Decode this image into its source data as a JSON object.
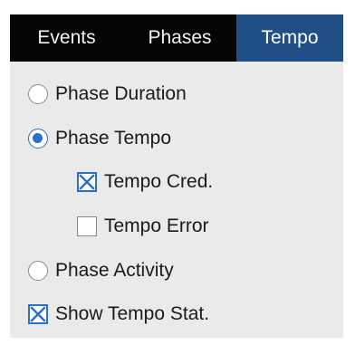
{
  "tabs": [
    {
      "label": "Events",
      "active": false
    },
    {
      "label": "Phases",
      "active": false
    },
    {
      "label": "Tempo",
      "active": true
    }
  ],
  "options": {
    "phase_duration": {
      "label": "Phase Duration",
      "type": "radio",
      "checked": false
    },
    "phase_tempo": {
      "label": "Phase Tempo",
      "type": "radio",
      "checked": true
    },
    "tempo_cred": {
      "label": "Tempo Cred.",
      "type": "checkbox",
      "checked": true
    },
    "tempo_error": {
      "label": "Tempo Error",
      "type": "checkbox",
      "checked": false
    },
    "phase_activity": {
      "label": "Phase Activity",
      "type": "radio",
      "checked": false
    },
    "show_tempo_stat": {
      "label": "Show Tempo Stat.",
      "type": "checkbox",
      "checked": true
    }
  },
  "colors": {
    "tab_bar": "#050505",
    "active_tab": "#1f4f86",
    "accent": "#2b6fc9",
    "panel_background": "#eaeaea"
  }
}
